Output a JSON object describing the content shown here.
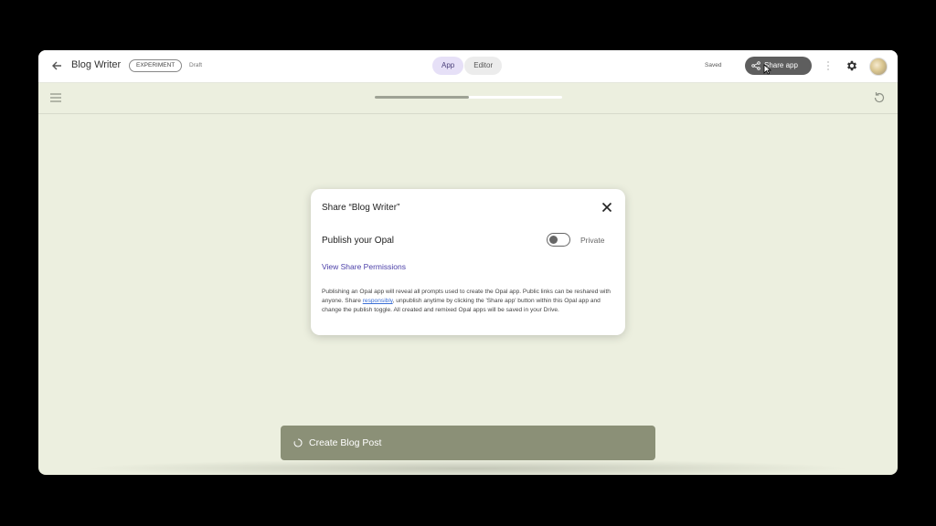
{
  "header": {
    "app_title": "Blog Writer",
    "badge": "EXPERIMENT",
    "status": "Draft",
    "tabs": [
      {
        "label": "App",
        "active": true
      },
      {
        "label": "Editor",
        "active": false
      }
    ],
    "saved_label": "Saved",
    "share_button_label": "Share app"
  },
  "toolbar": {
    "progress": 0.5
  },
  "dialog": {
    "title": "Share “Blog Writer”",
    "publish_label": "Publish your Opal",
    "toggle_state": "Private",
    "toggle_on": false,
    "permissions_link": "View Share Permissions",
    "description_before": "Publishing an Opal app will reveal all prompts used to create the Opal app. Public links can be reshared with anyone. Share ",
    "description_link": "responsibly",
    "description_after": ", unpublish anytime by clicking the 'Share app' button within this Opal app and change the publish toggle. All created and remixed Opal apps will be saved in your Drive."
  },
  "main": {
    "create_button_label": "Create Blog Post"
  },
  "icons": [
    "back-arrow-icon",
    "share-icon",
    "cursor-icon",
    "more-vert-icon",
    "gear-icon",
    "menu-icon",
    "refresh-icon",
    "close-icon",
    "spinner-icon"
  ],
  "colors": {
    "canvas": "#ecefdf",
    "share_button": "#5e5e5e",
    "create_button": "#8b9077",
    "link": "#4b3fa8",
    "active_tab": "#e6e0f7"
  }
}
